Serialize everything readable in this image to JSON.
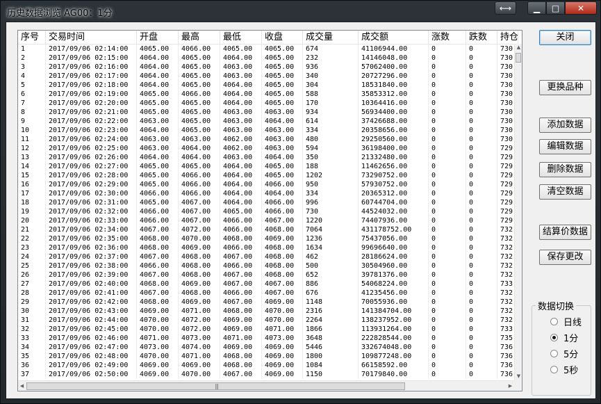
{
  "window": {
    "title": "历史数据浏览 AG00：1分",
    "swap_glyph": "⟷",
    "min_glyph": "▁",
    "max_glyph": "□",
    "close_glyph": "✕"
  },
  "table": {
    "columns": [
      "序号",
      "交易时间",
      "开盘",
      "最高",
      "最低",
      "收盘",
      "成交量",
      "成交额",
      "涨数",
      "跌数",
      "持仓"
    ],
    "rows": [
      [
        "1",
        "2017/09/06 02:14:00",
        "4065.00",
        "4066.00",
        "4065.00",
        "4065.00",
        "674",
        "41106944.00",
        "0",
        "0",
        "730"
      ],
      [
        "2",
        "2017/09/06 02:15:00",
        "4064.00",
        "4065.00",
        "4064.00",
        "4065.00",
        "232",
        "14146048.00",
        "0",
        "0",
        "730"
      ],
      [
        "3",
        "2017/09/06 02:16:00",
        "4064.00",
        "4065.00",
        "4063.00",
        "4065.00",
        "936",
        "57062400.00",
        "0",
        "0",
        "730"
      ],
      [
        "4",
        "2017/09/06 02:17:00",
        "4064.00",
        "4065.00",
        "4063.00",
        "4065.00",
        "340",
        "20727296.00",
        "0",
        "0",
        "730"
      ],
      [
        "5",
        "2017/09/06 02:18:00",
        "4064.00",
        "4065.00",
        "4064.00",
        "4065.00",
        "304",
        "18531840.00",
        "0",
        "0",
        "730"
      ],
      [
        "6",
        "2017/09/06 02:19:00",
        "4065.00",
        "4066.00",
        "4064.00",
        "4065.00",
        "588",
        "35853312.00",
        "0",
        "0",
        "730"
      ],
      [
        "7",
        "2017/09/06 02:20:00",
        "4065.00",
        "4065.00",
        "4064.00",
        "4065.00",
        "170",
        "10364416.00",
        "0",
        "0",
        "730"
      ],
      [
        "8",
        "2017/09/06 02:21:00",
        "4065.00",
        "4065.00",
        "4063.00",
        "4063.00",
        "934",
        "56934400.00",
        "0",
        "0",
        "730"
      ],
      [
        "9",
        "2017/09/06 02:22:00",
        "4063.00",
        "4065.00",
        "4063.00",
        "4064.00",
        "614",
        "37426688.00",
        "0",
        "0",
        "730"
      ],
      [
        "10",
        "2017/09/06 02:23:00",
        "4064.00",
        "4065.00",
        "4063.00",
        "4063.00",
        "334",
        "20358656.00",
        "0",
        "0",
        "730"
      ],
      [
        "11",
        "2017/09/06 02:24:00",
        "4063.00",
        "4063.00",
        "4062.00",
        "4063.00",
        "480",
        "29250560.00",
        "0",
        "0",
        "730"
      ],
      [
        "12",
        "2017/09/06 02:25:00",
        "4063.00",
        "4064.00",
        "4062.00",
        "4063.00",
        "594",
        "36198400.00",
        "0",
        "0",
        "729"
      ],
      [
        "13",
        "2017/09/06 02:26:00",
        "4064.00",
        "4064.00",
        "4063.00",
        "4064.00",
        "350",
        "21332480.00",
        "0",
        "0",
        "729"
      ],
      [
        "14",
        "2017/09/06 02:27:00",
        "4065.00",
        "4065.00",
        "4064.00",
        "4065.00",
        "188",
        "11462656.00",
        "0",
        "0",
        "729"
      ],
      [
        "15",
        "2017/09/06 02:28:00",
        "4065.00",
        "4066.00",
        "4064.00",
        "4065.00",
        "1202",
        "73290752.00",
        "0",
        "0",
        "729"
      ],
      [
        "16",
        "2017/09/06 02:29:00",
        "4065.00",
        "4066.00",
        "4064.00",
        "4066.00",
        "950",
        "57930752.00",
        "0",
        "0",
        "729"
      ],
      [
        "17",
        "2017/09/06 02:30:00",
        "4066.00",
        "4066.00",
        "4064.00",
        "4064.00",
        "334",
        "20365312.00",
        "0",
        "0",
        "729"
      ],
      [
        "18",
        "2017/09/06 02:31:00",
        "4065.00",
        "4067.00",
        "4064.00",
        "4066.00",
        "996",
        "60744704.00",
        "0",
        "0",
        "729"
      ],
      [
        "19",
        "2017/09/06 02:32:00",
        "4066.00",
        "4067.00",
        "4065.00",
        "4066.00",
        "730",
        "44524032.00",
        "0",
        "0",
        "729"
      ],
      [
        "20",
        "2017/09/06 02:33:00",
        "4066.00",
        "4067.00",
        "4066.00",
        "4067.00",
        "1220",
        "74407936.00",
        "0",
        "0",
        "729"
      ],
      [
        "21",
        "2017/09/06 02:34:00",
        "4067.00",
        "4072.00",
        "4066.00",
        "4068.00",
        "7064",
        "431178752.00",
        "0",
        "0",
        "732"
      ],
      [
        "22",
        "2017/09/06 02:35:00",
        "4068.00",
        "4070.00",
        "4068.00",
        "4069.00",
        "1236",
        "75437056.00",
        "0",
        "0",
        "732"
      ],
      [
        "23",
        "2017/09/06 02:36:00",
        "4068.00",
        "4069.00",
        "4066.00",
        "4068.00",
        "1634",
        "99696640.00",
        "0",
        "0",
        "732"
      ],
      [
        "24",
        "2017/09/06 02:37:00",
        "4067.00",
        "4068.00",
        "4067.00",
        "4068.00",
        "462",
        "28186624.00",
        "0",
        "0",
        "732"
      ],
      [
        "25",
        "2017/09/06 02:38:00",
        "4066.00",
        "4068.00",
        "4066.00",
        "4068.00",
        "500",
        "30504960.00",
        "0",
        "0",
        "732"
      ],
      [
        "26",
        "2017/09/06 02:39:00",
        "4067.00",
        "4068.00",
        "4067.00",
        "4068.00",
        "652",
        "39781376.00",
        "0",
        "0",
        "732"
      ],
      [
        "27",
        "2017/09/06 02:40:00",
        "4068.00",
        "4069.00",
        "4067.00",
        "4067.00",
        "886",
        "54068224.00",
        "0",
        "0",
        "733"
      ],
      [
        "28",
        "2017/09/06 02:41:00",
        "4067.00",
        "4068.00",
        "4066.00",
        "4067.00",
        "676",
        "41235456.00",
        "0",
        "0",
        "732"
      ],
      [
        "29",
        "2017/09/06 02:42:00",
        "4068.00",
        "4069.00",
        "4067.00",
        "4069.00",
        "1148",
        "70055936.00",
        "0",
        "0",
        "732"
      ],
      [
        "30",
        "2017/09/06 02:43:00",
        "4069.00",
        "4071.00",
        "4068.00",
        "4070.00",
        "2316",
        "141384704.00",
        "0",
        "0",
        "732"
      ],
      [
        "31",
        "2017/09/06 02:44:00",
        "4070.00",
        "4072.00",
        "4069.00",
        "4070.00",
        "2264",
        "138237952.00",
        "0",
        "0",
        "732"
      ],
      [
        "32",
        "2017/09/06 02:45:00",
        "4070.00",
        "4072.00",
        "4069.00",
        "4071.00",
        "1866",
        "113931264.00",
        "0",
        "0",
        "733"
      ],
      [
        "33",
        "2017/09/06 02:46:00",
        "4071.00",
        "4073.00",
        "4071.00",
        "4073.00",
        "3648",
        "222828544.00",
        "0",
        "0",
        "735"
      ],
      [
        "34",
        "2017/09/06 02:47:00",
        "4073.00",
        "4074.00",
        "4069.00",
        "4069.00",
        "5446",
        "332674048.00",
        "0",
        "0",
        "736"
      ],
      [
        "35",
        "2017/09/06 02:48:00",
        "4070.00",
        "4071.00",
        "4068.00",
        "4069.00",
        "1800",
        "109877248.00",
        "0",
        "0",
        "736"
      ],
      [
        "36",
        "2017/09/06 02:49:00",
        "4069.00",
        "4069.00",
        "4068.00",
        "4069.00",
        "1084",
        "66158592.00",
        "0",
        "0",
        "736"
      ],
      [
        "37",
        "2017/09/06 02:50:00",
        "4069.00",
        "4070.00",
        "4067.00",
        "4069.00",
        "1150",
        "70179840.00",
        "0",
        "0",
        "736"
      ]
    ]
  },
  "buttons": {
    "close": "关闭",
    "switch_symbol": "更换品种",
    "add": "添加数据",
    "edit": "编辑数据",
    "delete": "删除数据",
    "clear": "清空数据",
    "settle": "结算价数据",
    "save": "保存更改"
  },
  "data_switch": {
    "title": "数据切换",
    "options": [
      "日线",
      "1分",
      "5分",
      "5秒"
    ],
    "selected": "1分"
  },
  "icons": {
    "scroll_up": "▲",
    "scroll_down": "▼",
    "scroll_left": "◀",
    "scroll_right": "▶",
    "grip": "|||"
  }
}
